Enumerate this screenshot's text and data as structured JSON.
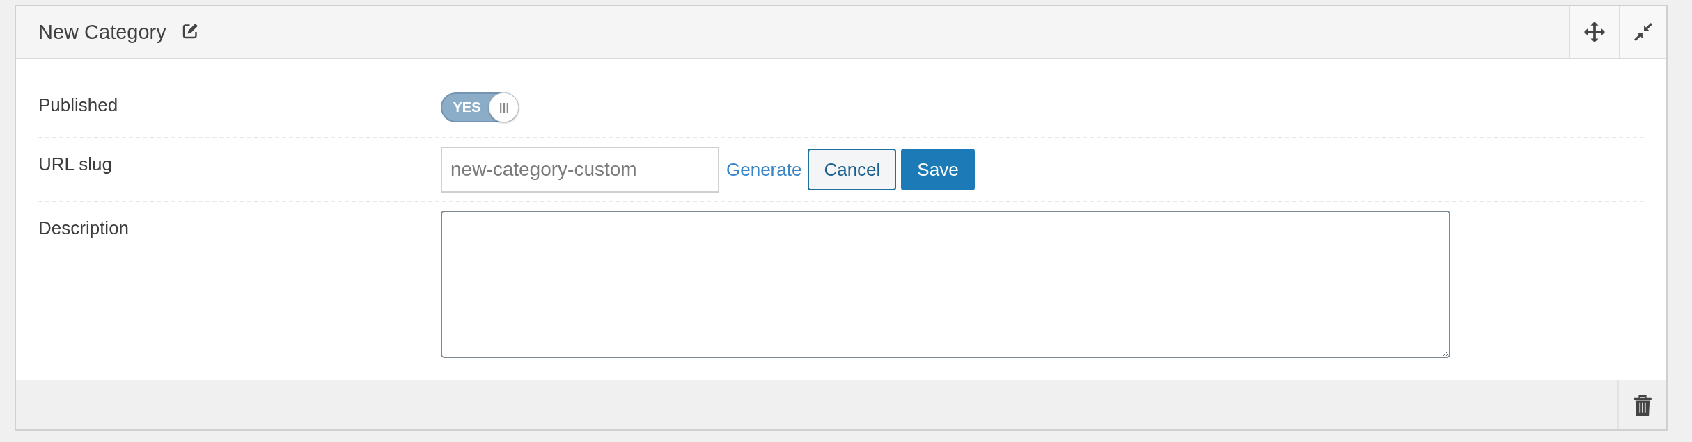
{
  "panel": {
    "title": "New Category",
    "fields": [
      {
        "kind": "toggle",
        "label": "Published",
        "on": true,
        "text": "YES"
      },
      {
        "kind": "slug",
        "label": "URL slug",
        "value": "new-category-custom",
        "link": "Generate",
        "buttons": [
          {
            "kind": "secondary",
            "label": "Cancel"
          },
          {
            "kind": "primary",
            "label": "Save"
          }
        ]
      },
      {
        "kind": "textarea",
        "label": "Description"
      }
    ]
  }
}
